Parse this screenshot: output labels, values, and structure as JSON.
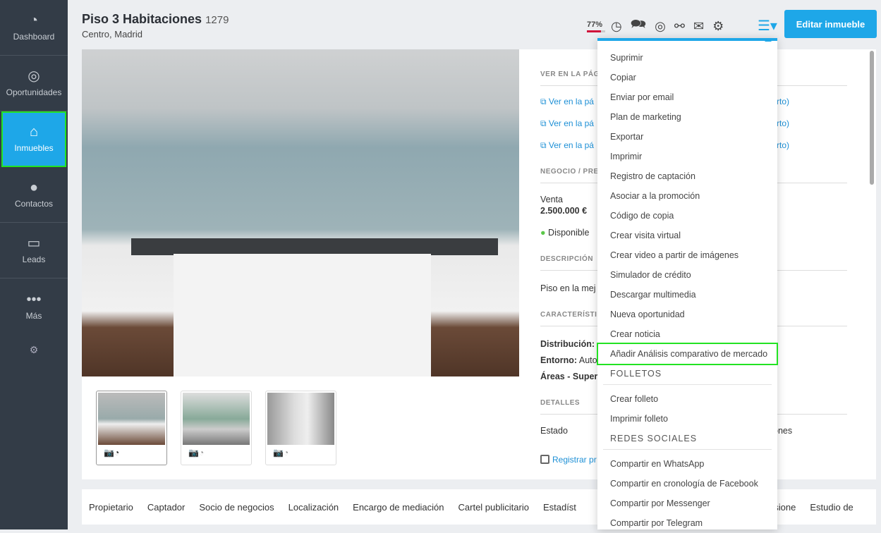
{
  "sidebar": {
    "items": [
      {
        "label": "Dashboard",
        "icon": "gauge-icon"
      },
      {
        "label": "Oportunidades",
        "icon": "target-icon"
      },
      {
        "label": "Inmuebles",
        "icon": "home-icon",
        "active": true
      },
      {
        "label": "Contactos",
        "icon": "person-icon"
      },
      {
        "label": "Leads",
        "icon": "inbox-icon"
      },
      {
        "label": "Más",
        "icon": "dots-icon"
      }
    ]
  },
  "header": {
    "title": "Piso 3 Habitaciones",
    "ref": "1279",
    "location": "Centro, Madrid",
    "completion": "77%",
    "completion_value": 77,
    "edit_label": "Editar inmueble"
  },
  "colors": {
    "accent": "#1ea7e8",
    "sidebar": "#333c47",
    "available": "#5cc84a",
    "completion": "#d0103a"
  },
  "details": {
    "ver_section": "VER EN LA PÁGI",
    "links": [
      "Ver en la pá",
      "Ver en la pá",
      "Ver en la pá"
    ],
    "link_tail": "rto)",
    "negocio_section": "NEGOCIO / PRE",
    "op": "Venta",
    "price": "2.500.000 €",
    "status": "Disponible",
    "desc_section": "DESCRIPCIÓN",
    "desc": "Piso en la mej",
    "car_section": "CARACTERÍSTI",
    "dist": "Distribución: S",
    "entorno": "Entorno:",
    "entorno_val": "Auto",
    "areas": "Áreas - Super",
    "detalles_section": "DETALLES",
    "estado": "Estado",
    "estado_tail": "ones",
    "registrar": "Registrar pr"
  },
  "menu": {
    "items": [
      "Suprimir",
      "Copiar",
      "Enviar por email",
      "Plan de marketing",
      "Exportar",
      "Imprimir",
      "Registro de captación",
      "Asociar a la promoción",
      "Código de copia",
      "Crear visita virtual",
      "Crear video a partir de imágenes",
      "Simulador de crédito",
      "Descargar multimedia",
      "Nueva oportunidad",
      "Crear noticia",
      "Añadir Análisis comparativo de mercado"
    ],
    "folletos_header": "FOLLETOS",
    "folletos": [
      "Crear folleto",
      "Imprimir folleto"
    ],
    "redes_header": "REDES SOCIALES",
    "redes": [
      "Compartir en WhatsApp",
      "Compartir en cronología de Facebook",
      "Compartir por Messenger",
      "Compartir por Telegram"
    ]
  },
  "tabs": [
    "Propietario",
    "Captador",
    "Socio de negocios",
    "Localización",
    "Encargo de mediación",
    "Cartel publicitario",
    "Estadíst",
    "Comisione",
    "Estudio de"
  ]
}
